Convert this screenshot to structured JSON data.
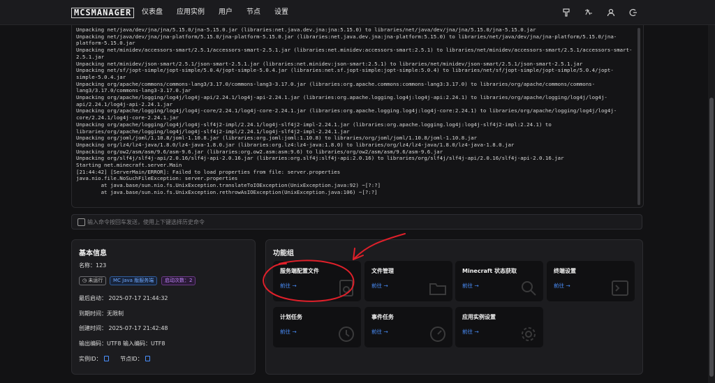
{
  "nav": {
    "logo": "MCSMANAGER",
    "items": [
      "仪表盘",
      "应用实例",
      "用户",
      "节点",
      "设置"
    ]
  },
  "console": {
    "lines": [
      "Unpacking net/java/dev/jna/jna/5.15.0/jna-5.15.0.jar (libraries:net.java.dev.jna:jna:5.15.0) to libraries/net/java/dev/jna/jna/5.15.0/jna-5.15.0.jar",
      "Unpacking net/java/dev/jna/jna-platform/5.15.0/jna-platform-5.15.0.jar (libraries:net.java.dev.jna:jna-platform:5.15.0) to libraries/net/java/dev/jna/jna-platform/5.15.0/jna-platform-5.15.0.jar",
      "Unpacking net/minidev/accessors-smart/2.5.1/accessors-smart-2.5.1.jar (libraries:net.minidev:accessors-smart:2.5.1) to libraries/net/minidev/accessors-smart/2.5.1/accessors-smart-2.5.1.jar",
      "Unpacking net/minidev/json-smart/2.5.1/json-smart-2.5.1.jar (libraries:net.minidev:json-smart:2.5.1) to libraries/net/minidev/json-smart/2.5.1/json-smart-2.5.1.jar",
      "Unpacking net/sf/jopt-simple/jopt-simple/5.0.4/jopt-simple-5.0.4.jar (libraries:net.sf.jopt-simple:jopt-simple:5.0.4) to libraries/net/sf/jopt-simple/jopt-simple/5.0.4/jopt-simple-5.0.4.jar",
      "Unpacking org/apache/commons/commons-lang3/3.17.0/commons-lang3-3.17.0.jar (libraries:org.apache.commons:commons-lang3:3.17.0) to libraries/org/apache/commons/commons-lang3/3.17.0/commons-lang3-3.17.0.jar",
      "Unpacking org/apache/logging/log4j/log4j-api/2.24.1/log4j-api-2.24.1.jar (libraries:org.apache.logging.log4j:log4j-api:2.24.1) to libraries/org/apache/logging/log4j/log4j-api/2.24.1/log4j-api-2.24.1.jar",
      "Unpacking org/apache/logging/log4j/log4j-core/2.24.1/log4j-core-2.24.1.jar (libraries:org.apache.logging.log4j:log4j-core:2.24.1) to libraries/org/apache/logging/log4j/log4j-core/2.24.1/log4j-core-2.24.1.jar",
      "Unpacking org/apache/logging/log4j/log4j-slf4j2-impl/2.24.1/log4j-slf4j2-impl-2.24.1.jar (libraries:org.apache.logging.log4j:log4j-slf4j2-impl:2.24.1) to libraries/org/apache/logging/log4j/log4j-slf4j2-impl/2.24.1/log4j-slf4j2-impl-2.24.1.jar",
      "Unpacking org/joml/joml/1.10.8/joml-1.10.8.jar (libraries:org.joml:joml:1.10.8) to libraries/org/joml/joml/1.10.8/joml-1.10.8.jar",
      "Unpacking org/lz4/lz4-java/1.8.0/lz4-java-1.8.0.jar (libraries:org.lz4:lz4-java:1.8.0) to libraries/org/lz4/lz4-java/1.8.0/lz4-java-1.8.0.jar",
      "Unpacking org/ow2/asm/asm/9.6/asm-9.6.jar (libraries:org.ow2.asm:asm:9.6) to libraries/org/ow2/asm/asm/9.6/asm-9.6.jar",
      "Unpacking org/slf4j/slf4j-api/2.0.16/slf4j-api-2.0.16.jar (libraries:org.slf4j:slf4j-api:2.0.16) to libraries/org/slf4j/slf4j-api/2.0.16/slf4j-api-2.0.16.jar",
      "Starting net.minecraft.server.Main",
      "[21:44:42] [ServerMain/ERROR]: Failed to load properties from file: server.properties",
      "java.nio.file.NoSuchFileException: server.properties",
      "        at java.base/sun.nio.fs.UnixException.translateToIOException(UnixException.java:92) ~[?:?]",
      "        at java.base/sun.nio.fs.UnixException.rethrowAsIOException(UnixException.java:106) ~[?:?]"
    ]
  },
  "command": {
    "placeholder": "输入命令按回车发送，使用上下键选择历史命令"
  },
  "info": {
    "title": "基本信息",
    "name": "名称：123",
    "status_badge": "未运行",
    "type_badge": "MC Java 版服务端",
    "starts_badge": "启动次数：2",
    "last_start": "最后启动：  2025-07-17 21:44:32",
    "expire": "到期时间：无限制",
    "created": "创建时间：  2025-07-17 21:42:48",
    "encoding": "输出编码：UTF8  输入编码：UTF8",
    "instance_id": "实例ID：",
    "node_id": "节点ID："
  },
  "func": {
    "title": "功能组",
    "cards": [
      {
        "title": "服务端配置文件",
        "link": "前往 →"
      },
      {
        "title": "文件管理",
        "link": "前往 →"
      },
      {
        "title": "Minecraft 状态获取",
        "link": "前往 →"
      },
      {
        "title": "终端设置",
        "link": "前往 →"
      },
      {
        "title": "计划任务",
        "link": "前往 →"
      },
      {
        "title": "事件任务",
        "link": "前往 →"
      },
      {
        "title": "应用实例设置",
        "link": "前往 →"
      }
    ]
  },
  "colors": {
    "accent": "#4a90ff",
    "annotation": "#e0202a"
  }
}
